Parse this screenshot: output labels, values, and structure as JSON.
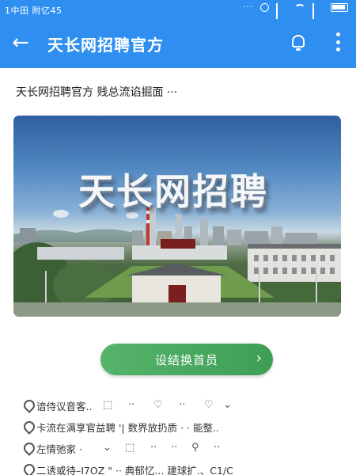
{
  "status_bar": {
    "time": "1中田 附亿45"
  },
  "app_bar": {
    "title": "天长网招聘官方"
  },
  "headline": "天长网招聘官方 贱总流谄掘面 ···",
  "banner": {
    "title": "天长网招聘"
  },
  "cta": {
    "label": "设结换首员"
  },
  "feed": {
    "rows": [
      {
        "text": "谙侍议音客.."
      },
      {
        "text": "卡流在满享官益聘 '| 数界放扔质 · · 能整.."
      },
      {
        "text": "左情弛家 ·"
      },
      {
        "text": "二诱或待–I7OZ \" ·· 典郁忆... 建球扩.、C1/C"
      }
    ]
  },
  "colors": {
    "brand_blue": "#2f8ff0",
    "cta_green": "#48a85e"
  }
}
